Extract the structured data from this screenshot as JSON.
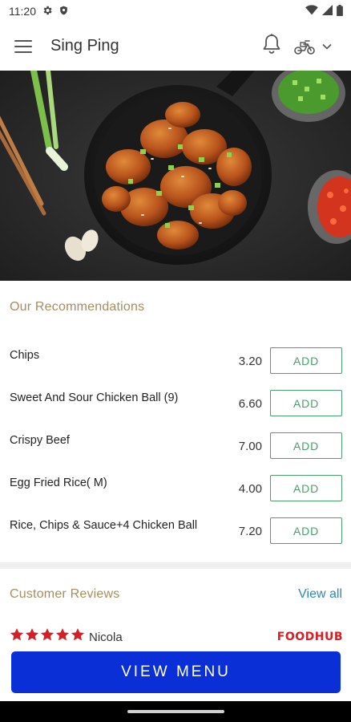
{
  "status_bar": {
    "time": "11:20",
    "icons": [
      "gear-icon",
      "shield-icon",
      "wifi-icon",
      "signal-icon",
      "battery-icon"
    ]
  },
  "app_bar": {
    "title": "Sing Ping",
    "icons": [
      "menu-icon",
      "bell-icon",
      "scooter-icon",
      "chevron-down-icon"
    ]
  },
  "hero": {
    "image": "chicken-dish-photo"
  },
  "recommendations": {
    "title": "Our Recommendations",
    "button_label": "ADD",
    "items": [
      {
        "name": "Chips",
        "price": "3.20"
      },
      {
        "name": "Sweet And Sour Chicken Ball (9)",
        "price": "6.60"
      },
      {
        "name": "Crispy Beef",
        "price": "7.00"
      },
      {
        "name": "Egg Fried Rice( M)",
        "price": "4.00"
      },
      {
        "name": "Rice, Chips & Sauce+4 Chicken Ball",
        "price": "7.20"
      }
    ]
  },
  "reviews": {
    "title": "Customer Reviews",
    "view_all": "View all",
    "items": [
      {
        "rating": 5,
        "reviewer": "Nicola",
        "source": "FOODHUB"
      }
    ]
  },
  "cta": {
    "label": "VIEW MENU"
  },
  "colors": {
    "accent_gold": "#a58d5f",
    "add_green": "#49a06c",
    "link_blue": "#2f86b8",
    "cta_blue": "#0a2fd6",
    "star_red": "#d41f26"
  }
}
